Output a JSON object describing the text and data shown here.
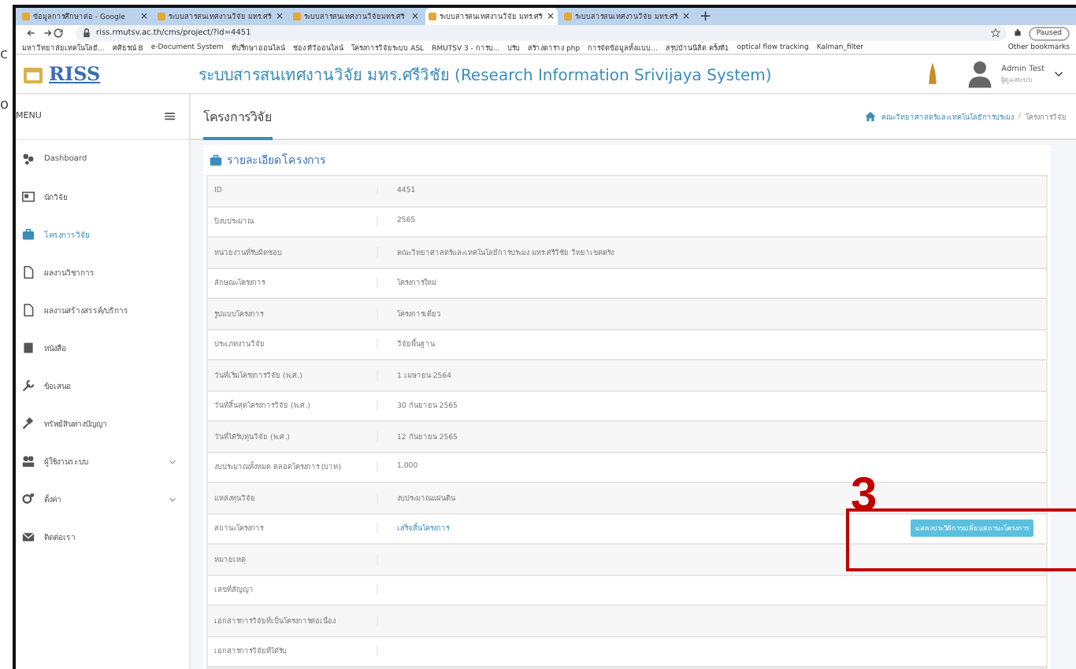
{
  "background_window": {
    "texts": [
      "c",
      "o"
    ]
  },
  "browser": {
    "tabs": [
      {
        "title": "ข้อมูลการศึกษาต่อ - Google",
        "close": "×",
        "selected": false
      },
      {
        "title": "ระบบสารสนเทศงานวิจัย มทร.ศรี",
        "close": "×",
        "selected": false
      },
      {
        "title": "ระบบสารสนเทศงานวิจัยมทร.ศรี",
        "close": "×",
        "selected": false
      },
      {
        "title": "ระบบสารสนเทศงานวิจัย มทร.ศรี",
        "close": "×",
        "selected": true
      },
      {
        "title": "ระบบสารสนเทศงานวิจัย มทร.ศรี",
        "close": "×",
        "selected": false
      }
    ],
    "new_tab": "+",
    "url": "riss.rmutsv.ac.th/cms/project/?id=4451",
    "profile": "Paused",
    "bookmarks": [
      "มหาวิทยาลัยเทคโนโลยี...",
      "ศศิธรณ์ B",
      "e-Document System",
      "ที่ปรึกษาออนไลน์",
      "ช่อง ทีวีออนไลน์",
      "โครงการวิจัยระบบ ASL",
      "RMUTSV 3 - การบ...",
      "ปรับ",
      "สร้างตาราง php",
      "การจัดข้อมูลทั้งแบบ...",
      "สรุปบ้านนิสิต ครั้งที่1",
      "optical flow tracking",
      "Kalman_filter"
    ],
    "other_bookmarks": "Other bookmarks"
  },
  "app": {
    "logo": "RISS",
    "title": "ระบบสารสนเทศงานวิจัย มทร.ศรีวิชัย (Research Information Srivijaya System)",
    "user": {
      "name": "Admin Test",
      "role": "ผู้ดูแลระบบ"
    }
  },
  "sidebar": {
    "heading": "MENU",
    "toggle": "≡",
    "items": [
      {
        "label": "Dashboard",
        "kind": "dashboard",
        "selected": false,
        "expandable": false
      },
      {
        "label": "นักวิจัย",
        "kind": "card",
        "selected": false,
        "expandable": false
      },
      {
        "label": "โครงการวิจัย",
        "kind": "briefcase",
        "selected": true,
        "expandable": false
      },
      {
        "label": "ผลงานวิชาการ",
        "kind": "file",
        "selected": false,
        "expandable": false
      },
      {
        "label": "ผลงานสร้างสรรค์/บริการ",
        "kind": "file",
        "selected": false,
        "expandable": false
      },
      {
        "label": "หนังสือ",
        "kind": "book",
        "selected": false,
        "expandable": false
      },
      {
        "label": "ข้อเสนอ",
        "kind": "wrench",
        "selected": false,
        "expandable": false
      },
      {
        "label": "ทรัพย์สินทางปัญญา",
        "kind": "gavel",
        "selected": false,
        "expandable": false
      },
      {
        "label": "ผู้ใช้งานระบบ",
        "kind": "users",
        "selected": false,
        "expandable": true
      },
      {
        "label": "ตั้งค่า",
        "kind": "gears",
        "selected": false,
        "expandable": true
      },
      {
        "label": "ติดต่อเรา",
        "kind": "mail",
        "selected": false,
        "expandable": false
      }
    ]
  },
  "page": {
    "title": "โครงการวิจัย",
    "breadcrumb": [
      "คณะวิทยาศาสตร์และเทคโนโลยีการประมง",
      "โครงการวิจัย"
    ],
    "breadcrumb_separator": "/"
  },
  "card": {
    "title": "รายละเอียดโครงการ",
    "rows": [
      {
        "label": "ID",
        "value": "4451",
        "kind": "text"
      },
      {
        "label": "ปีงบประมาณ",
        "value": "2565",
        "kind": "text"
      },
      {
        "label": "หน่วยงานที่รับผิดชอบ",
        "value": "คณะวิทยาศาสตร์และเทคโนโลยีการประมง มทร.ศรีวิชัย วิทยาเขตตรัง",
        "kind": "text"
      },
      {
        "label": "ลักษณะโครงการ",
        "value": "โครงการใหม่",
        "kind": "text"
      },
      {
        "label": "รูปแบบโครงการ",
        "value": "โครงการเดี่ยว",
        "kind": "text"
      },
      {
        "label": "ประเภทงานวิจัย",
        "value": "วิจัยพื้นฐาน",
        "kind": "text"
      },
      {
        "label": "วันที่เริ่มโครงการวิจัย (พ.ศ.)",
        "value": "1 เมษายน 2564",
        "kind": "text"
      },
      {
        "label": "วันที่สิ้นสุดโครงการวิจัย (พ.ศ.)",
        "value": "30 กันยายน 2565",
        "kind": "text"
      },
      {
        "label": "วันที่ได้รับทุนวิจัย (พ.ศ.)",
        "value": "12 กันยายน 2565",
        "kind": "text"
      },
      {
        "label": "งบประมาณทั้งหมด ตลอดโครงการ (บาท)",
        "value": "1,000",
        "kind": "text"
      },
      {
        "label": "แหล่งทุนวิจัย",
        "value": "งบประมาณแผ่นดิน",
        "kind": "text"
      },
      {
        "label": "สถานะโครงการ",
        "value": "เสร็จสิ้นโครงการ",
        "kind": "link",
        "button": "แสดงประวัติการเปลี่ยนสถานะโครงการ"
      },
      {
        "label": "หมายเหตุ",
        "kind": "empty"
      },
      {
        "label": "เลขที่สัญญา",
        "kind": "empty"
      },
      {
        "label": "เอกสารการวิจัยที่เป็นโครงการต่อเนื่อง",
        "kind": "empty"
      },
      {
        "label": "เอกสารการวิจัยที่ได้รับ",
        "kind": "empty"
      }
    ]
  },
  "annotation": {
    "label": "3"
  }
}
